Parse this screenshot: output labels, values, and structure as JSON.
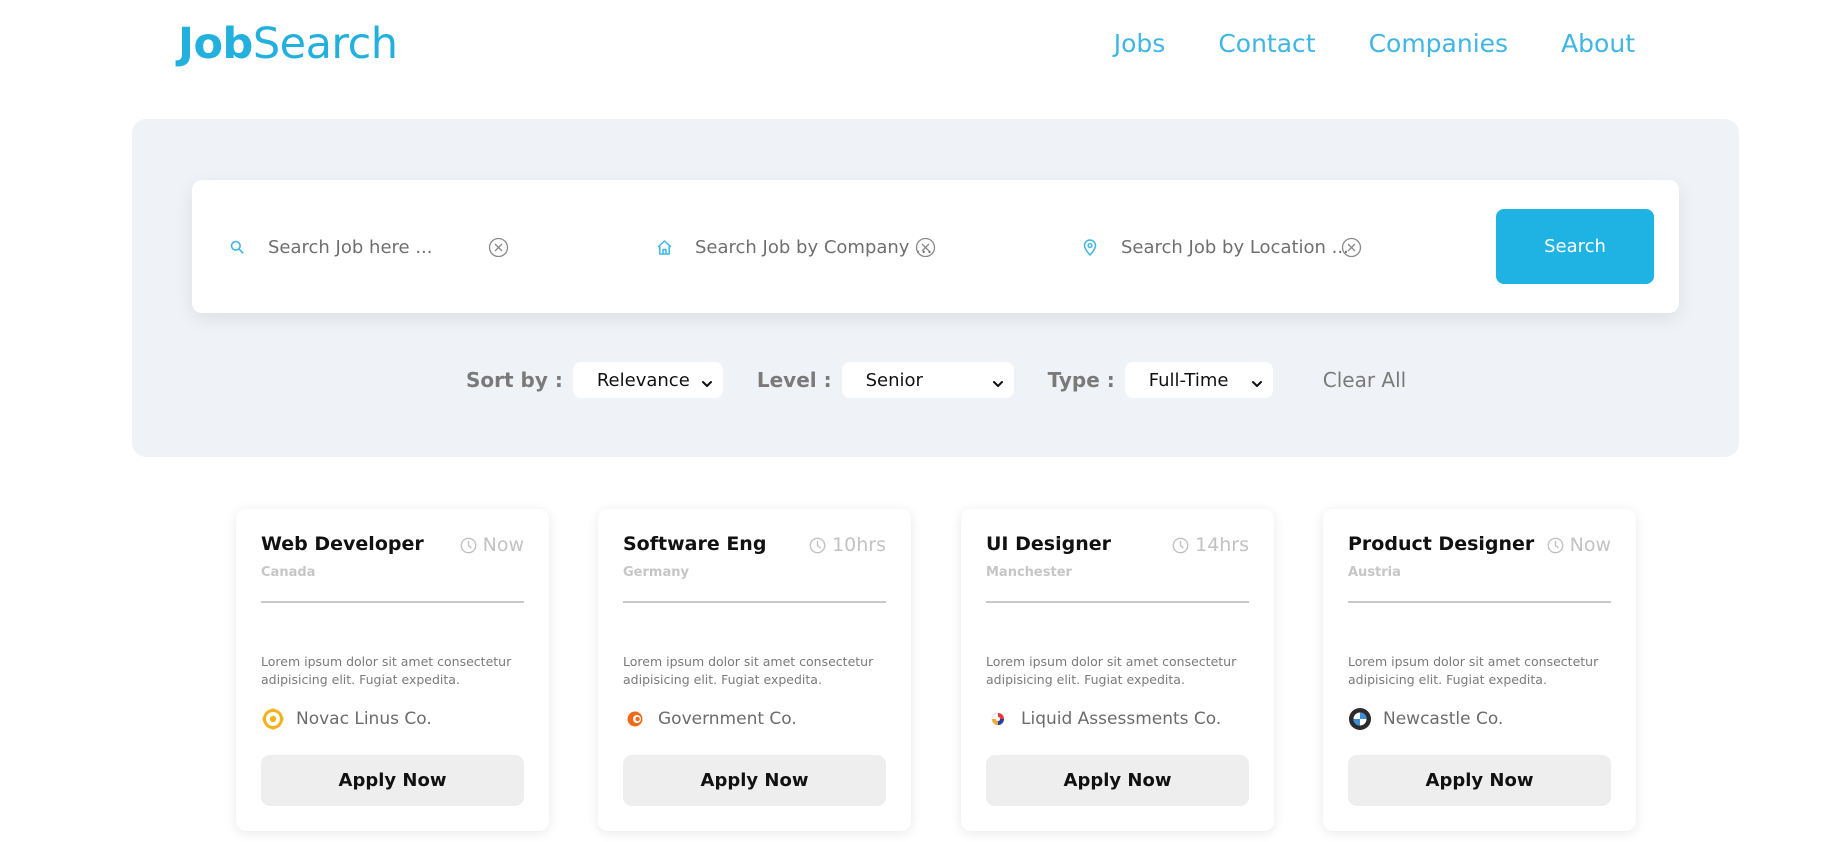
{
  "header": {
    "logo_bold": "Job",
    "logo_light": "Search",
    "nav": [
      "Jobs",
      "Contact",
      "Companies",
      "About"
    ]
  },
  "search": {
    "job_placeholder": "Search Job here ...",
    "company_placeholder": "Search Job by Company ...",
    "location_placeholder": "Search Job by Location ...",
    "button_label": "Search"
  },
  "filters": {
    "sort_label": "Sort by :",
    "sort_value": "Relevance",
    "level_label": "Level :",
    "level_value": "Senior",
    "type_label": "Type :",
    "type_value": "Full-Time",
    "clear_all": "Clear All"
  },
  "jobs": [
    {
      "title": "Web Developer",
      "time": "Now",
      "location": "Canada",
      "description": "Lorem ipsum dolor sit amet consectetur adipisicing elit. Fugiat expedita.",
      "company": "Novac Linus Co.",
      "logo_icon": "novac-linus-logo-icon",
      "apply_label": "Apply Now"
    },
    {
      "title": "Software Eng",
      "time": "10hrs",
      "location": "Germany",
      "description": "Lorem ipsum dolor sit amet consectetur adipisicing elit. Fugiat expedita.",
      "company": "Government Co.",
      "logo_icon": "government-logo-icon",
      "apply_label": "Apply Now"
    },
    {
      "title": "UI Designer",
      "time": "14hrs",
      "location": "Manchester",
      "description": "Lorem ipsum dolor sit amet consectetur adipisicing elit. Fugiat expedita.",
      "company": "Liquid Assessments Co.",
      "logo_icon": "liquid-assessments-logo-icon",
      "apply_label": "Apply Now"
    },
    {
      "title": "Product Designer",
      "time": "Now",
      "location": "Austria",
      "description": "Lorem ipsum dolor sit amet consectetur adipisicing elit. Fugiat expedita.",
      "company": "Newcastle Co.",
      "logo_icon": "newcastle-logo-icon",
      "apply_label": "Apply Now"
    }
  ],
  "colors": {
    "brand": "#22b0de",
    "nav": "#3fb6e4",
    "search_button": "#1eb3e2",
    "panel_bg": "#eff2f6",
    "apply_bg": "#eeeeee"
  }
}
